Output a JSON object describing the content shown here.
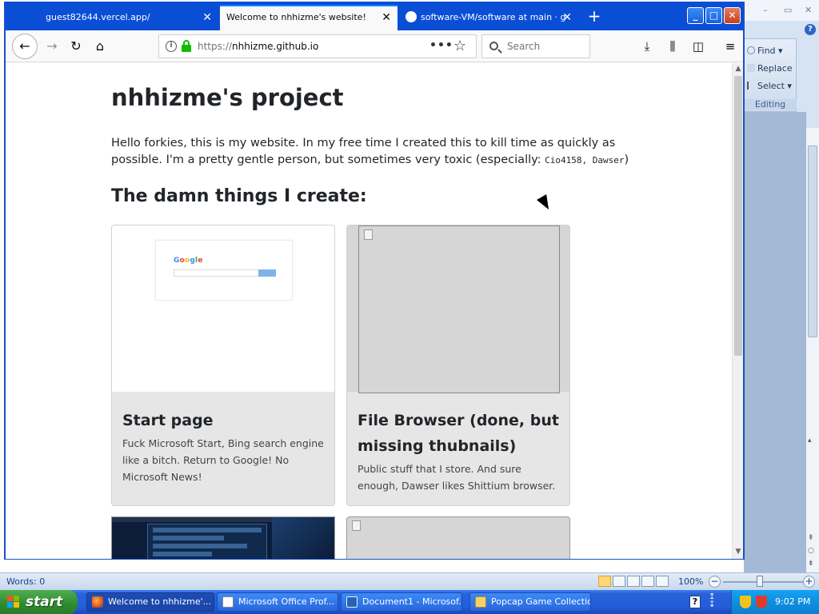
{
  "word": {
    "ribbon": {
      "find_label": "Find",
      "replace_label": "Replace",
      "select_label": "Select",
      "group_label": "Editing"
    },
    "status": {
      "words": "Words: 0",
      "zoom": "100%"
    }
  },
  "firefox": {
    "tabs": [
      {
        "label": "guest82644.vercel.app/",
        "active": false
      },
      {
        "label": "Welcome to nhhizme's website!",
        "active": true
      },
      {
        "label": "software-VM/software at main · g",
        "active": false
      }
    ],
    "new_tab": "+",
    "url": {
      "scheme": "https://",
      "host": "nhhizme.github.io"
    },
    "page_actions": "•••",
    "search_placeholder": "Search"
  },
  "page": {
    "title": "nhhizme's project",
    "intro_text": "Hello forkies, this is my website. In my free time I created this to kill time as quickly as possible. I'm a pretty gentle person, but sometimes very toxic (especially: ",
    "intro_code": "Cio4158, Dawser",
    "intro_end": ")",
    "section_heading": "The damn things I create:",
    "cards": [
      {
        "title": "Start page",
        "description": "Fuck Microsoft Start, Bing search engine like a bitch. Return to Google! No Microsoft News!",
        "thumb_logo": "Google"
      },
      {
        "title": "File Browser (done, but missing thubnails)",
        "description": "Public stuff that I store. And sure enough, Dawser likes Shittium browser."
      }
    ]
  },
  "taskbar": {
    "start_label": "start",
    "tasks": [
      {
        "label": "Welcome to nhhizme'...",
        "active": true,
        "icon": "firefox-icon"
      },
      {
        "label": "Microsoft Office Prof...",
        "active": false,
        "icon": "office-icon"
      },
      {
        "label": "Document1 - Microsof...",
        "active": false,
        "icon": "word-icon"
      },
      {
        "label": "Popcap Game Collection",
        "active": false,
        "icon": "folder-icon"
      }
    ],
    "clock": "9:02 PM"
  },
  "colors": {
    "firefox_tabstrip": "#0a4ed6",
    "accent_blue": "#0a84ff",
    "xp_start_green": "#2f8a2f",
    "xp_taskbar_blue": "#245ddb"
  }
}
